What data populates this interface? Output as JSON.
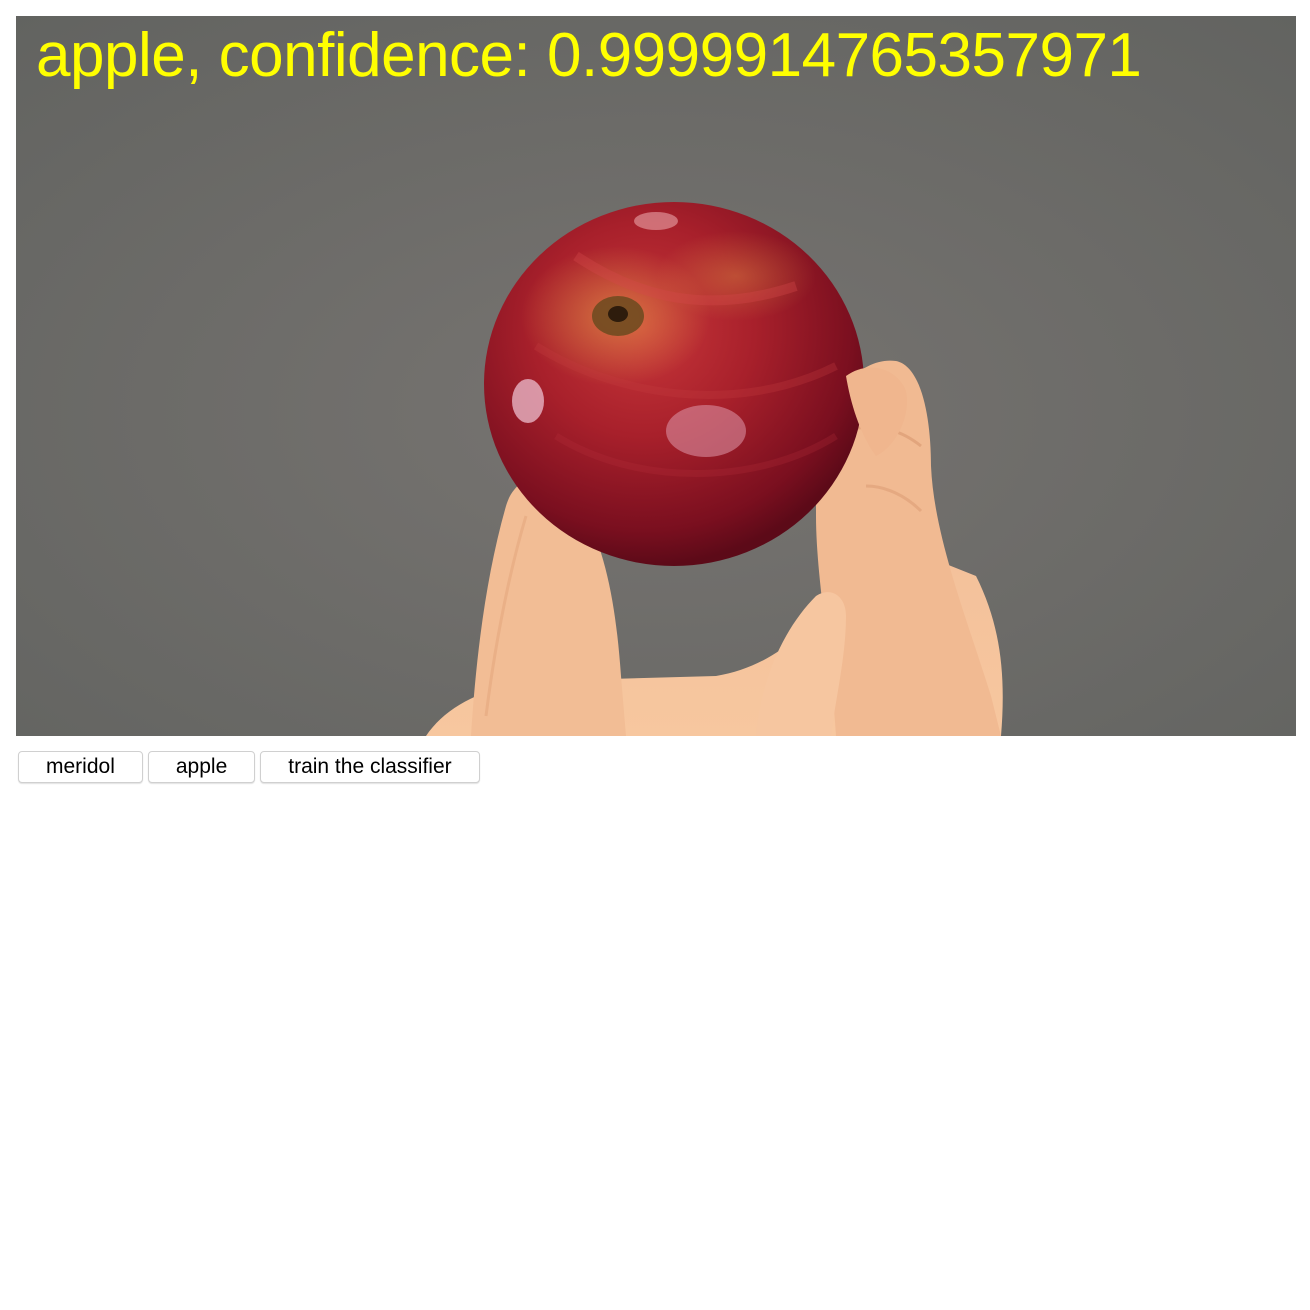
{
  "video": {
    "prediction_text": "apple, confidence: 0.9999914765357971",
    "label_color": "#ffff00",
    "subject": "red apple held between thumb and fingers against grey background"
  },
  "controls": {
    "buttons": [
      {
        "label": "meridol"
      },
      {
        "label": "apple"
      },
      {
        "label": "train the classifier"
      }
    ]
  },
  "colors": {
    "background": "#ffffff",
    "video_backdrop": "#6f6d6a",
    "apple_red": "#9c1a26",
    "skin": "#f0b48c"
  }
}
